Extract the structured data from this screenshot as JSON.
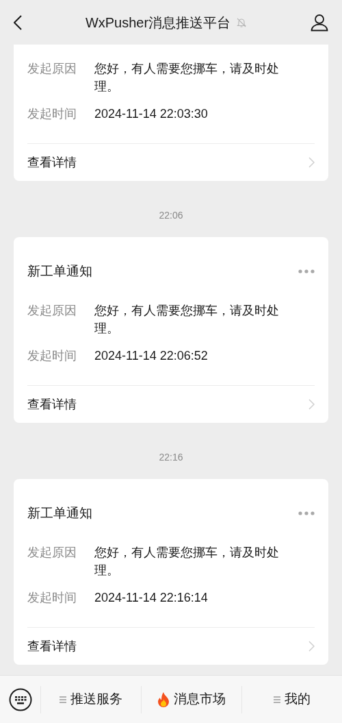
{
  "header": {
    "title": "WxPusher消息推送平台",
    "muted": true
  },
  "messages": [
    {
      "fields": [
        {
          "label": "发起原因",
          "value": "您好，有人需要您挪车，请及时处理。"
        },
        {
          "label": "发起时间",
          "value": "2024-11-14 22:03:30"
        }
      ],
      "link": "查看详情"
    },
    {
      "time_label": "22:06",
      "title": "新工单通知",
      "fields": [
        {
          "label": "发起原因",
          "value": "您好，有人需要您挪车，请及时处理。"
        },
        {
          "label": "发起时间",
          "value": "2024-11-14 22:06:52"
        }
      ],
      "link": "查看详情"
    },
    {
      "time_label": "22:16",
      "title": "新工单通知",
      "fields": [
        {
          "label": "发起原因",
          "value": "您好，有人需要您挪车，请及时处理。"
        },
        {
          "label": "发起时间",
          "value": "2024-11-14 22:16:14"
        }
      ],
      "link": "查看详情"
    }
  ],
  "menu": [
    {
      "label": "推送服务",
      "kind": "submenu"
    },
    {
      "label": "消息市场",
      "kind": "hot"
    },
    {
      "label": "我的",
      "kind": "submenu"
    }
  ]
}
